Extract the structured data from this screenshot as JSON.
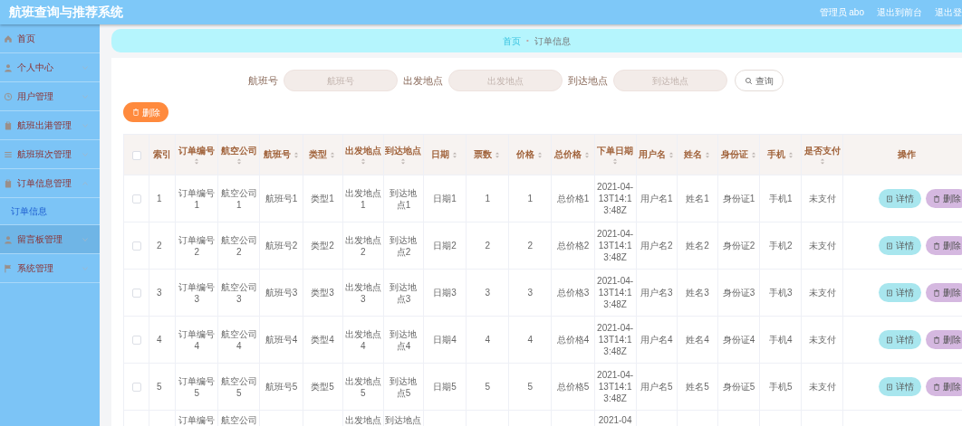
{
  "header": {
    "title": "航班查询与推荐系统",
    "links": [
      "管理员 abo",
      "退出到前台",
      "退出登"
    ]
  },
  "sidebar": {
    "items": [
      {
        "kind": "link",
        "label": "首页",
        "hovered": false
      },
      {
        "kind": "group",
        "label": "个人中心",
        "expanded": false,
        "hovered": false
      },
      {
        "kind": "group",
        "label": "用户管理",
        "expanded": false,
        "hovered": false
      },
      {
        "kind": "group",
        "label": "航班出港管理",
        "expanded": false,
        "hovered": false
      },
      {
        "kind": "group",
        "label": "航班班次管理",
        "expanded": false,
        "hovered": false
      },
      {
        "kind": "group",
        "label": "订单信息管理",
        "expanded": true,
        "hovered": false,
        "children": [
          {
            "label": "订单信息",
            "selected": true
          }
        ]
      },
      {
        "kind": "group",
        "label": "留言板管理",
        "expanded": false,
        "hovered": true
      },
      {
        "kind": "group",
        "label": "系统管理",
        "expanded": false,
        "hovered": false
      }
    ]
  },
  "breadcrumb": {
    "items": [
      "首页",
      "订单信息"
    ],
    "separator": "•"
  },
  "search": {
    "fields": [
      {
        "label": "航班号",
        "placeholder": "航班号"
      },
      {
        "label": "出发地点",
        "placeholder": "出发地点"
      },
      {
        "label": "到达地点",
        "placeholder": "到达地点"
      }
    ],
    "button": "查询"
  },
  "delete_button": "删除",
  "table": {
    "select_all": {
      "checked": false
    },
    "columns": [
      {
        "kind": "plain",
        "label": "索引"
      },
      {
        "kind": "sortable",
        "label": "订单编号"
      },
      {
        "kind": "sortable",
        "label": "航空公司"
      },
      {
        "kind": "sortable",
        "label": "航班号"
      },
      {
        "kind": "sortable",
        "label": "类型"
      },
      {
        "kind": "sortable",
        "label": "出发地点"
      },
      {
        "kind": "sortable",
        "label": "到达地点"
      },
      {
        "kind": "sortable",
        "label": "日期"
      },
      {
        "kind": "sortable",
        "label": "票数"
      },
      {
        "kind": "sortable",
        "label": "价格"
      },
      {
        "kind": "sortable",
        "label": "总价格"
      },
      {
        "kind": "sortable",
        "label": "下单日期"
      },
      {
        "kind": "sortable",
        "label": "用户名"
      },
      {
        "kind": "sortable",
        "label": "姓名"
      },
      {
        "kind": "sortable",
        "label": "身份证"
      },
      {
        "kind": "sortable",
        "label": "手机"
      },
      {
        "kind": "sortable",
        "label": "是否支付"
      },
      {
        "kind": "plain",
        "label": "操作"
      }
    ],
    "rows": [
      {
        "checked": false,
        "cells": [
          "1",
          "订单编号1",
          "航空公司1",
          "航班号1",
          "类型1",
          "出发地点1",
          "到达地点1",
          "日期1",
          "1",
          "1",
          "总价格1",
          "2021-04-13T14:13:48Z",
          "用户名1",
          "姓名1",
          "身份证1",
          "手机1",
          "未支付"
        ],
        "actions": [
          "详情",
          "删除"
        ]
      },
      {
        "checked": false,
        "cells": [
          "2",
          "订单编号2",
          "航空公司2",
          "航班号2",
          "类型2",
          "出发地点2",
          "到达地点2",
          "日期2",
          "2",
          "2",
          "总价格2",
          "2021-04-13T14:13:48Z",
          "用户名2",
          "姓名2",
          "身份证2",
          "手机2",
          "未支付"
        ],
        "actions": [
          "详情",
          "删除"
        ]
      },
      {
        "checked": false,
        "cells": [
          "3",
          "订单编号3",
          "航空公司3",
          "航班号3",
          "类型3",
          "出发地点3",
          "到达地点3",
          "日期3",
          "3",
          "3",
          "总价格3",
          "2021-04-13T14:13:48Z",
          "用户名3",
          "姓名3",
          "身份证3",
          "手机3",
          "未支付"
        ],
        "actions": [
          "详情",
          "删除"
        ]
      },
      {
        "checked": false,
        "cells": [
          "4",
          "订单编号4",
          "航空公司4",
          "航班号4",
          "类型4",
          "出发地点4",
          "到达地点4",
          "日期4",
          "4",
          "4",
          "总价格4",
          "2021-04-13T14:13:48Z",
          "用户名4",
          "姓名4",
          "身份证4",
          "手机4",
          "未支付"
        ],
        "actions": [
          "详情",
          "删除"
        ]
      },
      {
        "checked": false,
        "cells": [
          "5",
          "订单编号5",
          "航空公司5",
          "航班号5",
          "类型5",
          "出发地点5",
          "到达地点5",
          "日期5",
          "5",
          "5",
          "总价格5",
          "2021-04-13T14:13:48Z",
          "用户名5",
          "姓名5",
          "身份证5",
          "手机5",
          "未支付"
        ],
        "actions": [
          "详情",
          "删除"
        ]
      }
    ],
    "partial_row": {
      "order_number": "订单编号",
      "airline": "航空公司",
      "departure": "出发地点",
      "arrival": "到达地点",
      "order_date": "2021-04"
    }
  }
}
